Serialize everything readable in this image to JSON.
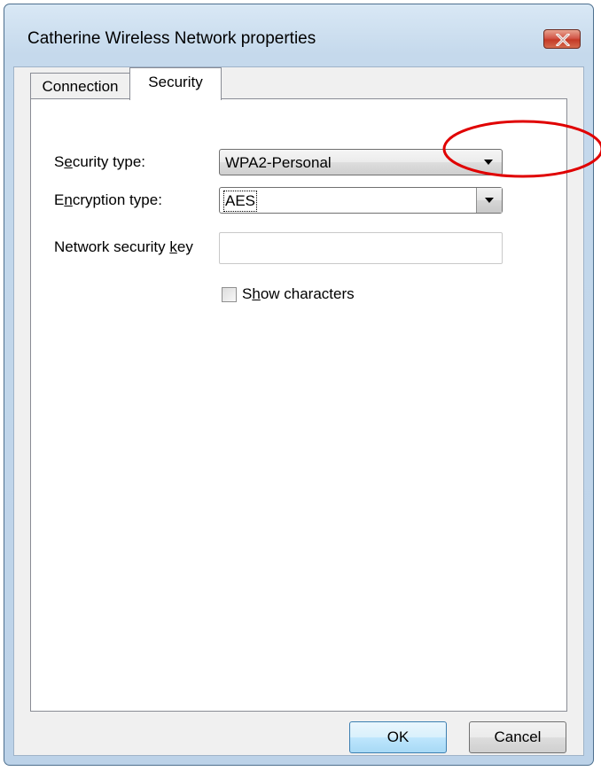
{
  "window": {
    "title": "Catherine Wireless Network properties"
  },
  "tabs": [
    {
      "label": "Connection",
      "selected": false
    },
    {
      "label": "Security",
      "selected": true
    }
  ],
  "security": {
    "security_type": {
      "label_pre": "S",
      "label_u": "e",
      "label_post": "curity type:",
      "value": "WPA2-Personal"
    },
    "encryption_type": {
      "label_pre": "E",
      "label_u": "n",
      "label_post": "cryption type:",
      "value": "AES"
    },
    "network_key": {
      "label_pre": "Network security ",
      "label_u": "k",
      "label_post": "ey",
      "value": ""
    },
    "show_characters": {
      "label_pre": "S",
      "label_u": "h",
      "label_post": "ow characters",
      "checked": false
    }
  },
  "buttons": {
    "ok": "OK",
    "cancel": "Cancel"
  },
  "annotation": {
    "color": "#e00000"
  }
}
